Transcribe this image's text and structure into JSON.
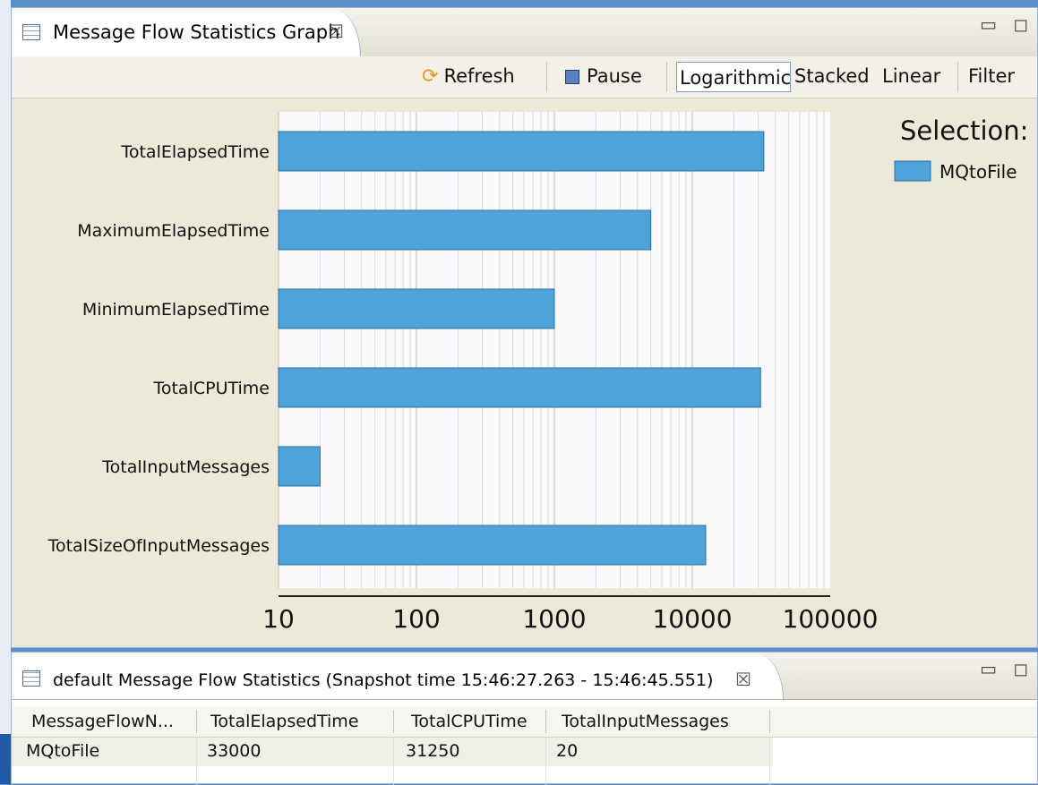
{
  "top_view": {
    "tab_title": "Message Flow Statistics Graph",
    "close_glyph": "☒",
    "window_glyphs": "▭ ◻"
  },
  "toolbar": {
    "refresh": "Refresh",
    "pause": "Pause",
    "logarithmic": "Logarithmic",
    "stacked": "Stacked",
    "linear": "Linear",
    "filter": "Filter"
  },
  "legend": {
    "title": "Selection:",
    "items": [
      {
        "label": "MQtoFile",
        "color": "#4fa3dc"
      }
    ]
  },
  "chart_data": {
    "type": "bar",
    "orientation": "horizontal",
    "scale": "log",
    "categories": [
      "TotalElapsedTime",
      "MaximumElapsedTime",
      "MinimumElapsedTime",
      "TotalCPUTime",
      "TotalInputMessages",
      "TotalSizeOfInputMessages"
    ],
    "series": [
      {
        "name": "MQtoFile",
        "values": [
          33000,
          5000,
          1000,
          31250,
          20,
          12500
        ],
        "color": "#4fa3dc"
      }
    ],
    "xticks": [
      10,
      100,
      1000,
      10000,
      100000
    ],
    "xtick_labels": [
      "10",
      "100",
      "1000",
      "10000",
      "100000"
    ],
    "xlim": [
      10,
      100000
    ],
    "grid": true
  },
  "bottom_view": {
    "tab_title": "default Message Flow Statistics (Snapshot time 15:46:27.263 - 15:46:45.551)",
    "close_glyph": "☒",
    "window_glyphs": "▭ ◻",
    "columns": [
      "MessageFlowN...",
      "TotalElapsedTime",
      "TotalCPUTime",
      "TotalInputMessages"
    ],
    "rows": [
      [
        "MQtoFile",
        "33000",
        "31250",
        "20"
      ]
    ]
  }
}
